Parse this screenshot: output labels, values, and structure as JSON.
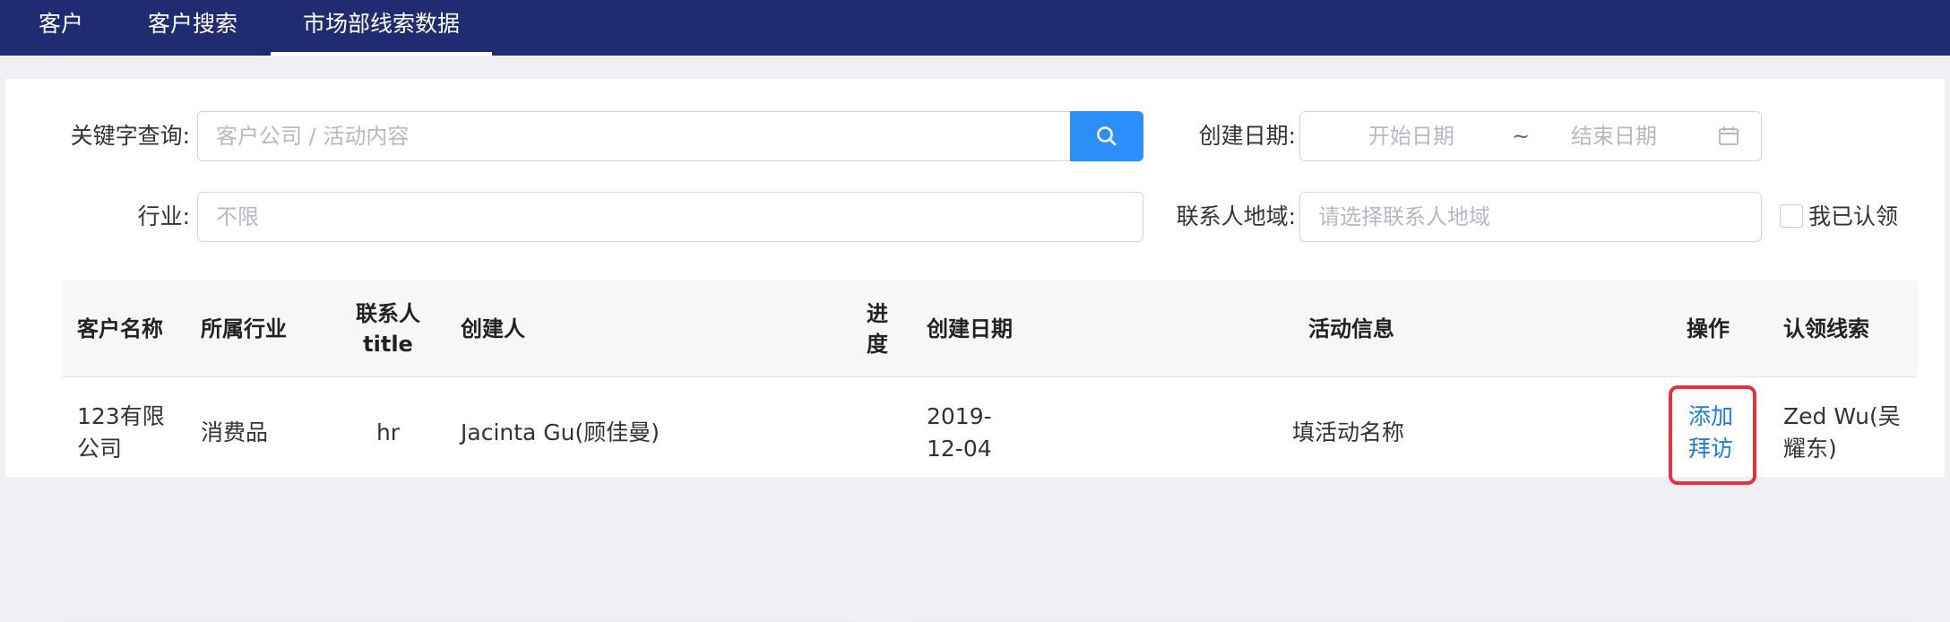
{
  "nav": {
    "tabs": [
      {
        "label": "客户"
      },
      {
        "label": "客户搜索"
      },
      {
        "label": "市场部线索数据"
      }
    ]
  },
  "filters": {
    "keyword_label": "关键字查询:",
    "keyword_placeholder": "客户公司 / 活动内容",
    "date_label": "创建日期:",
    "date_start_placeholder": "开始日期",
    "date_separator": "~",
    "date_end_placeholder": "结束日期",
    "industry_label": "行业:",
    "industry_placeholder": "不限",
    "region_label": "联系人地域:",
    "region_placeholder": "请选择联系人地域",
    "claimed_label": "我已认领"
  },
  "table": {
    "headers": {
      "customer": "客户名称",
      "industry": "所属行业",
      "contact_title_1": "联系人",
      "contact_title_2": "title",
      "creator": "创建人",
      "progress_1": "进",
      "progress_2": "度",
      "created": "创建日期",
      "activity": "活动信息",
      "action": "操作",
      "claim": "认领线索"
    },
    "rows": [
      {
        "customer_1": "123有限",
        "customer_2": "公司",
        "industry": "消费品",
        "title": "hr",
        "creator": "Jacinta Gu(顾佳曼)",
        "created_1": "2019-",
        "created_2": "12-04",
        "activity": "填活动名称",
        "action_1": "添加",
        "action_2": "拜访",
        "claim_1": "Zed Wu(吴",
        "claim_2": "耀东)"
      }
    ]
  },
  "colors": {
    "nav_bg": "#1f2c72",
    "primary": "#2c8ef8",
    "link": "#1a7ce6",
    "highlight": "#e83040"
  }
}
